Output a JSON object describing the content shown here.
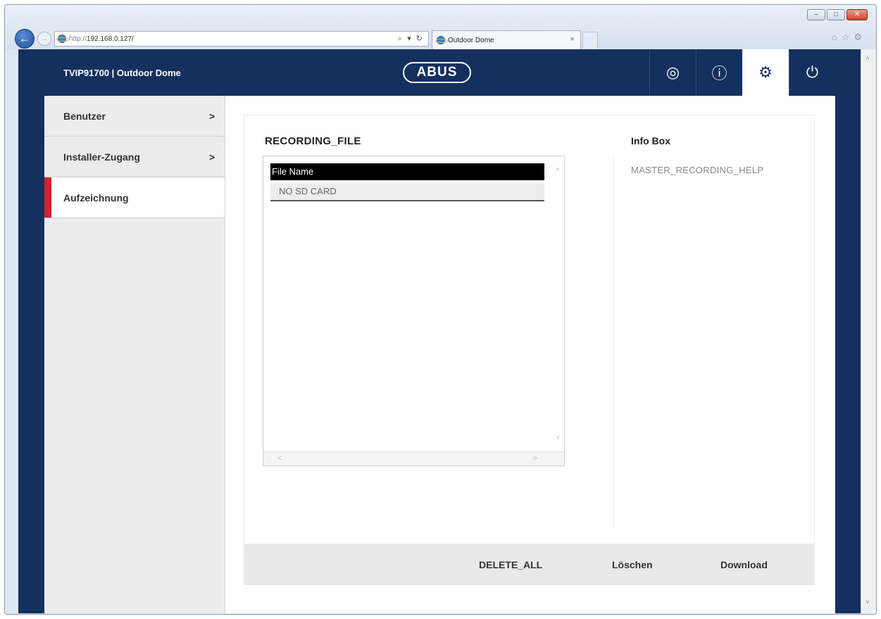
{
  "browser": {
    "url_proto": "http://",
    "url_host": "192.168.0.127/",
    "address_tools": "⌕ ▾ ↻",
    "tab_title": "Outdoor Dome",
    "tab_close": "×",
    "win_minimize": "–",
    "win_maximize": "□",
    "win_close": "✕",
    "back_glyph": "←",
    "forward_glyph": "→",
    "tools_glyphs": "⌂☆⚙"
  },
  "app": {
    "title": "TVIP91700 | Outdoor Dome",
    "logo": "ABUS",
    "header_icons": [
      {
        "name": "live-view-icon",
        "glyph": "◎"
      },
      {
        "name": "help-icon",
        "glyph": "ⓘ"
      },
      {
        "name": "settings-icon",
        "glyph": "⚙"
      },
      {
        "name": "power-icon",
        "glyph": "⏻"
      }
    ]
  },
  "sidebar": {
    "items": [
      {
        "label": "Benutzer",
        "chevron": ">"
      },
      {
        "label": "Installer-Zugang",
        "chevron": ">"
      },
      {
        "label": "Aufzeichnung",
        "chevron": ""
      }
    ]
  },
  "main": {
    "section_title": "RECORDING_FILE",
    "table": {
      "column_header": "File Name",
      "rows": [
        "NO SD CARD"
      ]
    },
    "info_box": {
      "title": "Info Box",
      "text": "MASTER_RECORDING_HELP"
    }
  },
  "actions": {
    "delete_all": "DELETE_ALL",
    "delete": "Löschen",
    "download": "Download"
  },
  "colors": {
    "header_bg": "#14305e",
    "active_accent": "#d8202e"
  }
}
